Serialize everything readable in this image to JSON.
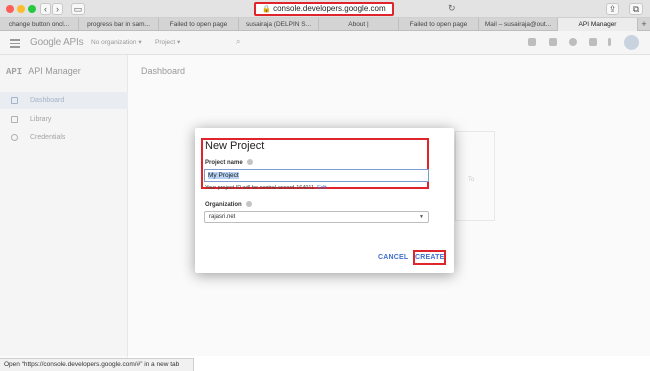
{
  "browser": {
    "url": "console.developers.google.com",
    "tabs": [
      "change button oncl...",
      "progress bar in sam...",
      "Failed to open page",
      "susairaja (DELPIN S...",
      "About |",
      "Failed to open page",
      "Mail – susairaja@out...",
      "API Manager"
    ],
    "status_text": "Open “https://console.developers.google.com/#” in a new tab"
  },
  "appbar": {
    "logo": "Google APIs",
    "org": "No organization ▾",
    "project": "Project ▾"
  },
  "sidebar": {
    "title_icon": "API",
    "title": "API Manager",
    "items": [
      {
        "label": "Dashboard",
        "icon": "dashboard-icon"
      },
      {
        "label": "Library",
        "icon": "library-icon"
      },
      {
        "label": "Credentials",
        "icon": "key-icon"
      }
    ]
  },
  "main": {
    "title": "Dashboard",
    "card_text": "To"
  },
  "dialog": {
    "title": "New Project",
    "project_name_label": "Project name",
    "project_name_value": "My Project",
    "project_id_text": "Your project ID will be central-accord-164911",
    "edit_label": "Edit",
    "organization_label": "Organization",
    "organization_value": "rajasri.net",
    "cancel_label": "CANCEL",
    "create_label": "CREATE"
  },
  "colors": {
    "highlight_red": "#e0242b",
    "link_blue": "#3f6fcf"
  }
}
